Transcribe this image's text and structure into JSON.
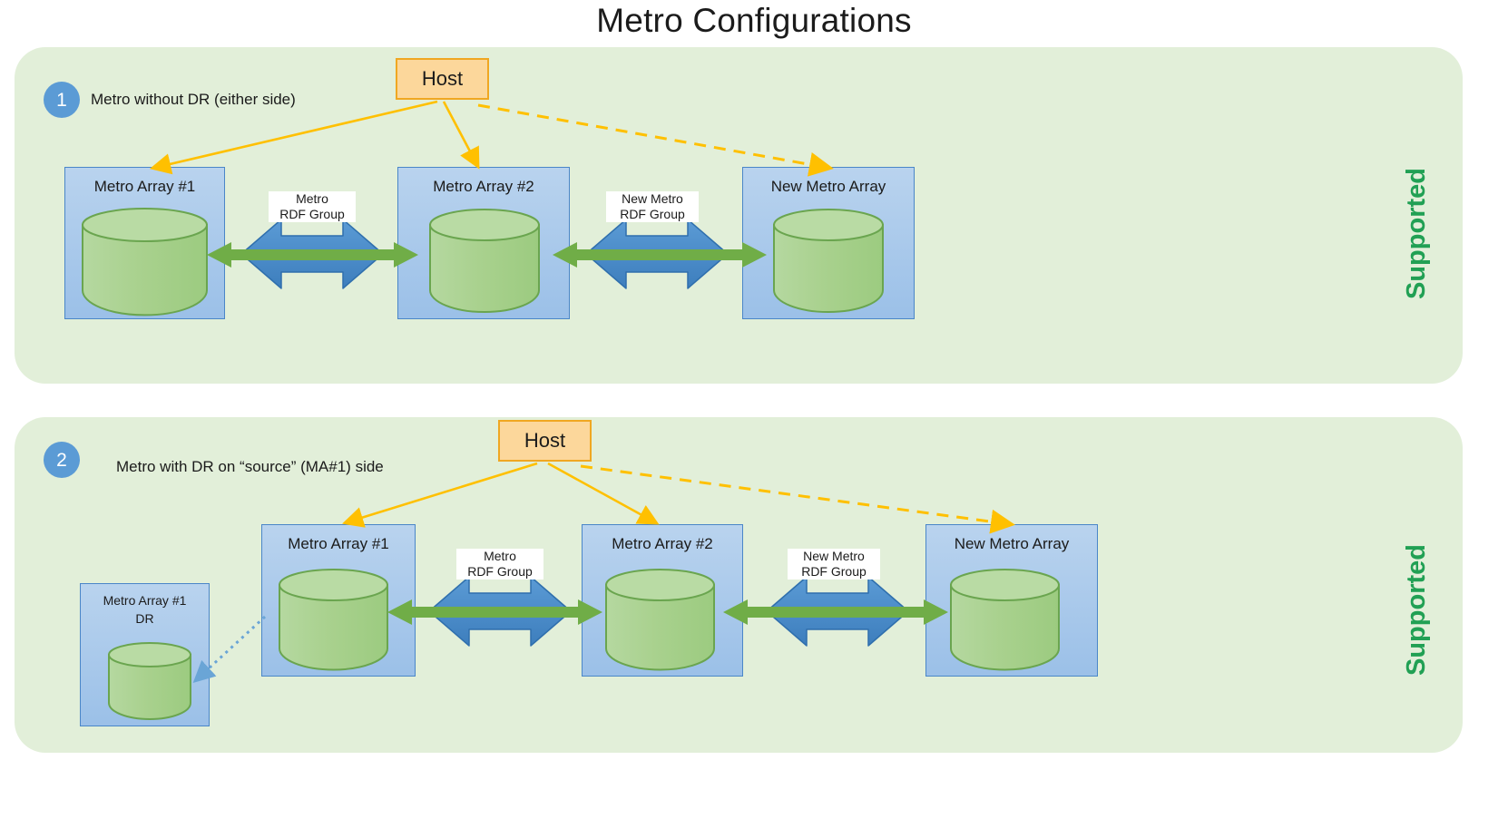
{
  "title": "Metro Configurations",
  "panels": [
    {
      "badge": "1",
      "caption": "Metro without DR (either side)",
      "status": "Supported",
      "host": {
        "label": "Host"
      },
      "arrays": [
        {
          "name": "metro-array-1",
          "label": "Metro Array #1"
        },
        {
          "name": "metro-array-2",
          "label": "Metro Array #2"
        },
        {
          "name": "new-metro-array",
          "label": "New Metro Array"
        }
      ],
      "links": [
        {
          "name": "metro-rdf-group",
          "line1": "Metro",
          "line2": "RDF Group"
        },
        {
          "name": "new-metro-rdf-group",
          "line1": "New Metro",
          "line2": "RDF Group"
        }
      ]
    },
    {
      "badge": "2",
      "caption": "Metro with DR on “source” (MA#1) side",
      "status": "Supported",
      "host": {
        "label": "Host"
      },
      "dr_array": {
        "name": "metro-array-1-dr",
        "line1": "Metro Array #1",
        "line2": "DR"
      },
      "arrays": [
        {
          "name": "metro-array-1",
          "label": "Metro Array #1"
        },
        {
          "name": "metro-array-2",
          "label": "Metro Array #2"
        },
        {
          "name": "new-metro-array",
          "label": "New Metro Array"
        }
      ],
      "links": [
        {
          "name": "metro-rdf-group",
          "line1": "Metro",
          "line2": "RDF Group"
        },
        {
          "name": "new-metro-rdf-group",
          "line1": "New Metro",
          "line2": "RDF Group"
        }
      ]
    }
  ],
  "colors": {
    "panel_background": "#e2efd9",
    "array_box": "#9bc0e8",
    "array_border": "#4a86c8",
    "host_fill": "#fcd79b",
    "host_border": "#f0a722",
    "cylinder_fill": "#a9d18e",
    "cylinder_border": "#6aa84f",
    "rdf_arrow": "#4a86c8",
    "replication_arrow": "#70ad47",
    "host_link": "#ffc000",
    "dr_link": "#5b9bd5",
    "badge": "#5b9bd5",
    "supported_text": "#21a054"
  }
}
